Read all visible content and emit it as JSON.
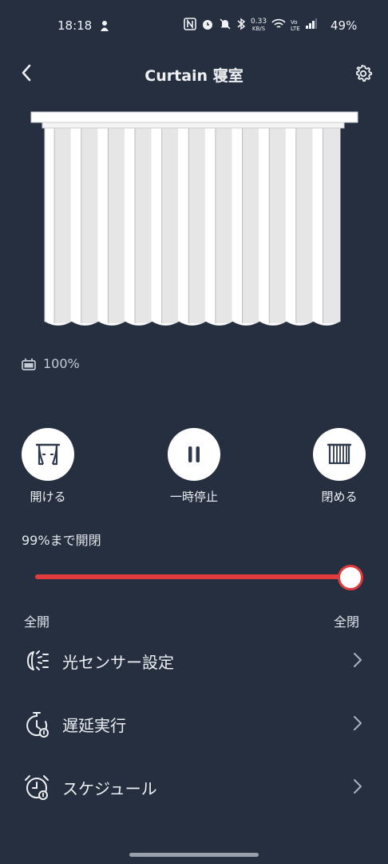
{
  "status_bar": {
    "time": "18:18",
    "net_speed_value": "0.33",
    "net_speed_unit": "KB/S",
    "volte_top": "Vo",
    "volte_bottom": "LTE",
    "battery": "49%"
  },
  "header": {
    "title": "Curtain 寝室"
  },
  "device": {
    "battery_level": "100%"
  },
  "controls": {
    "open_label": "開ける",
    "pause_label": "一時停止",
    "close_label": "閉める"
  },
  "position": {
    "label": "99%まで開閉",
    "value_percent": 99,
    "min_label": "全開",
    "max_label": "全閉"
  },
  "menu": {
    "items": [
      {
        "label": "光センサー設定",
        "icon": "light-sensor-icon"
      },
      {
        "label": "遅延実行",
        "icon": "timer-icon"
      },
      {
        "label": "スケジュール",
        "icon": "alarm-clock-icon"
      }
    ]
  },
  "colors": {
    "background": "#262f3f",
    "accent": "#e13b3d",
    "curtain_panel": "#e6e6e6"
  }
}
